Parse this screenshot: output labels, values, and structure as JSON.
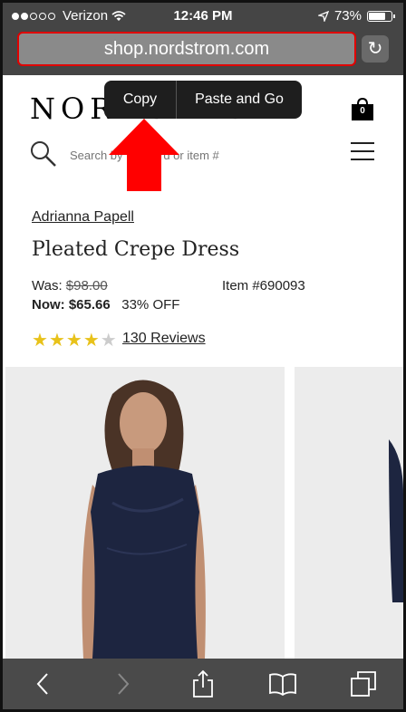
{
  "status": {
    "carrier": "Verizon",
    "time": "12:46 PM",
    "battery": "73%"
  },
  "browser": {
    "url": "shop.nordstrom.com",
    "popup": {
      "copy": "Copy",
      "paste_and_go": "Paste and Go"
    }
  },
  "header": {
    "logo": "NORDSTROM",
    "bag_count": "0",
    "search_placeholder": "Search by keyword or item #"
  },
  "product": {
    "brand": "Adrianna Papell",
    "title": "Pleated Crepe Dress",
    "was_label": "Was:",
    "was_price": "$98.00",
    "now_label": "Now:",
    "now_price": "$65.66",
    "discount": "33% OFF",
    "item_number": "Item #690093",
    "rating": 4.5,
    "reviews": "130 Reviews"
  },
  "colors": {
    "accent_red": "#e00000",
    "star": "#e8c21a",
    "chrome": "#454545"
  },
  "icons": [
    "wifi-icon",
    "location-arrow-icon",
    "battery-icon",
    "reload-icon",
    "bag-icon",
    "search-icon",
    "menu-icon",
    "back-icon",
    "forward-icon",
    "share-icon",
    "bookmarks-icon",
    "tabs-icon"
  ]
}
